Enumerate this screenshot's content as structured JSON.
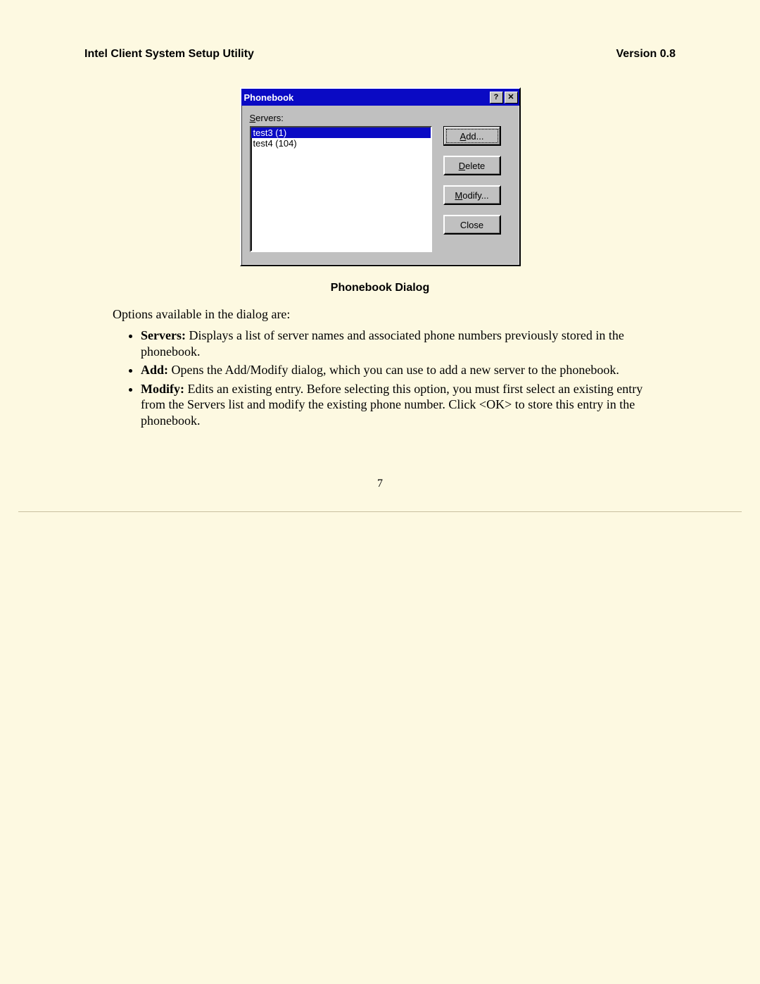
{
  "header": {
    "left": "Intel Client System Setup Utility",
    "right": "Version 0.8"
  },
  "dialog": {
    "title": "Phonebook",
    "help_glyph": "?",
    "close_glyph": "✕",
    "servers_label_prefix": "S",
    "servers_label_rest": "ervers:",
    "list": [
      {
        "text": "test3 (1)",
        "selected": true
      },
      {
        "text": "test4 (104)",
        "selected": false
      }
    ],
    "buttons": {
      "add": {
        "u": "A",
        "rest": "dd...",
        "default": true
      },
      "delete": {
        "u": "D",
        "rest": "elete"
      },
      "modify": {
        "u": "M",
        "rest": "odify..."
      },
      "close": {
        "u": "",
        "rest": "Close"
      }
    }
  },
  "caption": "Phonebook Dialog",
  "intro": "Options available in the dialog are:",
  "options": [
    {
      "term": "Servers:",
      "desc": "  Displays a list of server names and associated phone numbers previously stored in the phonebook."
    },
    {
      "term": "Add:",
      "desc": "  Opens the Add/Modify dialog, which you can use to add a new server to the phonebook."
    },
    {
      "term": "Modify:",
      "desc": " Edits an existing entry.  Before selecting this option, you must first select an existing entry from the Servers list and modify the existing phone number.  Click <OK> to store this entry in the phonebook."
    }
  ],
  "page_number": "7"
}
